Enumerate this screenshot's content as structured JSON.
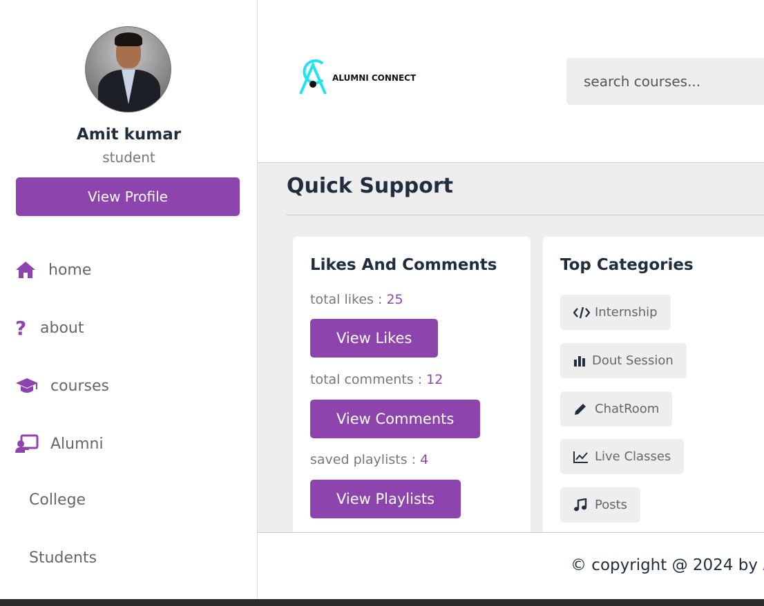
{
  "colors": {
    "accent": "#8e44ad",
    "heading": "#1f2d3d",
    "background": "#eeeeee"
  },
  "profile": {
    "name": "Amit kumar",
    "role": "student",
    "view_profile_label": "View Profile"
  },
  "nav": {
    "items": [
      {
        "label": "home",
        "icon": "home-icon"
      },
      {
        "label": "about",
        "icon": "question-icon"
      },
      {
        "label": "courses",
        "icon": "graduation-cap-icon"
      },
      {
        "label": "Alumni",
        "icon": "chalkboard-teacher-icon"
      }
    ],
    "plain_items": [
      {
        "label": "College"
      },
      {
        "label": "Students"
      }
    ]
  },
  "header": {
    "logo_text": "ALUMNI CONNECT",
    "search_placeholder": "search courses..."
  },
  "main": {
    "title": "Quick Support",
    "likes_card": {
      "title": "Likes And Comments",
      "likes_label": "total likes : ",
      "likes_value": "25",
      "likes_button": "View Likes",
      "comments_label": "total comments : ",
      "comments_value": "12",
      "comments_button": "View Comments",
      "playlists_label": "saved playlists : ",
      "playlists_value": "4",
      "playlists_button": "View Playlists"
    },
    "categories_card": {
      "title": "Top Categories",
      "tags": [
        {
          "label": "Internship",
          "icon": "code-icon"
        },
        {
          "label": "Dout Session",
          "icon": "bar-chart-icon"
        },
        {
          "label": "ChatRoom",
          "icon": "pencil-icon"
        },
        {
          "label": "Live Classes",
          "icon": "line-chart-icon"
        },
        {
          "label": "Posts",
          "icon": "music-icon"
        }
      ]
    }
  },
  "footer": {
    "text": "© copyright @ 2024 by ",
    "accent_text": "A"
  }
}
